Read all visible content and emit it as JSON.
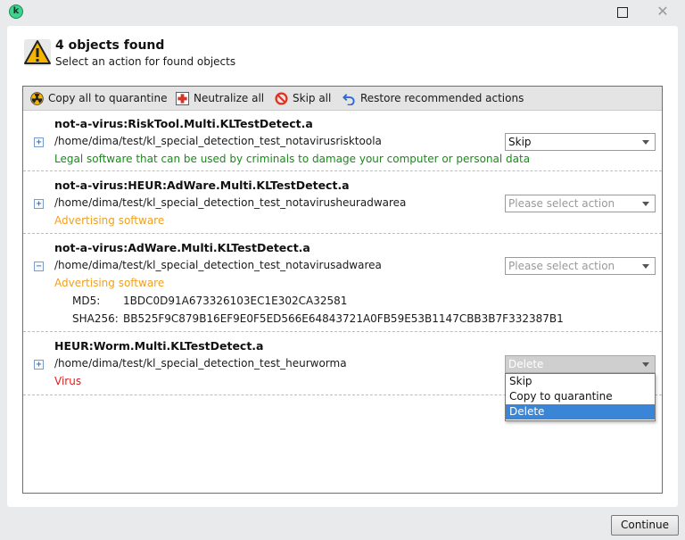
{
  "window": {
    "logo_letter": "k"
  },
  "header": {
    "title": "4 objects found",
    "subtitle": "Select an action for found objects"
  },
  "toolbar": {
    "copy_all": "Copy all to quarantine",
    "neutralize_all": "Neutralize all",
    "skip_all": "Skip all",
    "restore": "Restore recommended actions"
  },
  "objects": [
    {
      "name": "not-a-virus:RiskTool.Multi.KLTestDetect.a",
      "expand_symbol": "+",
      "path": "/home/dima/test/kl_special_detection_test_notavirusrisktoola",
      "description": "Legal software that can be used by criminals to damage your computer or personal data",
      "action": "Skip"
    },
    {
      "name": "not-a-virus:HEUR:AdWare.Multi.KLTestDetect.a",
      "expand_symbol": "+",
      "path": "/home/dima/test/kl_special_detection_test_notavirusheuradwarea",
      "description": "Advertising software",
      "action": "Please select action"
    },
    {
      "name": "not-a-virus:AdWare.Multi.KLTestDetect.a",
      "expand_symbol": "−",
      "path": "/home/dima/test/kl_special_detection_test_notavirusadwarea",
      "description": "Advertising software",
      "action": "Please select action",
      "md5_label": "MD5:",
      "md5": "1BDC0D91A673326103EC1E302CA32581",
      "sha256_label": "SHA256:",
      "sha256": "BB525F9C879B16EF9E0F5ED566E64843721A0FB59E53B1147CBB3B7F332387B1"
    },
    {
      "name": "HEUR:Worm.Multi.KLTestDetect.a",
      "expand_symbol": "+",
      "path": "/home/dima/test/kl_special_detection_test_heurworma",
      "description": "Virus",
      "action": "Delete"
    }
  ],
  "dropdown_options": [
    "Skip",
    "Copy to quarantine",
    "Delete"
  ],
  "dropdown_selected": "Delete",
  "continue_label": "Continue",
  "colors": {
    "riskware_desc": "#1a8a1a",
    "adware_desc": "#f0a020",
    "virus_desc": "#e02020",
    "selected_option": "#3a85d6"
  }
}
